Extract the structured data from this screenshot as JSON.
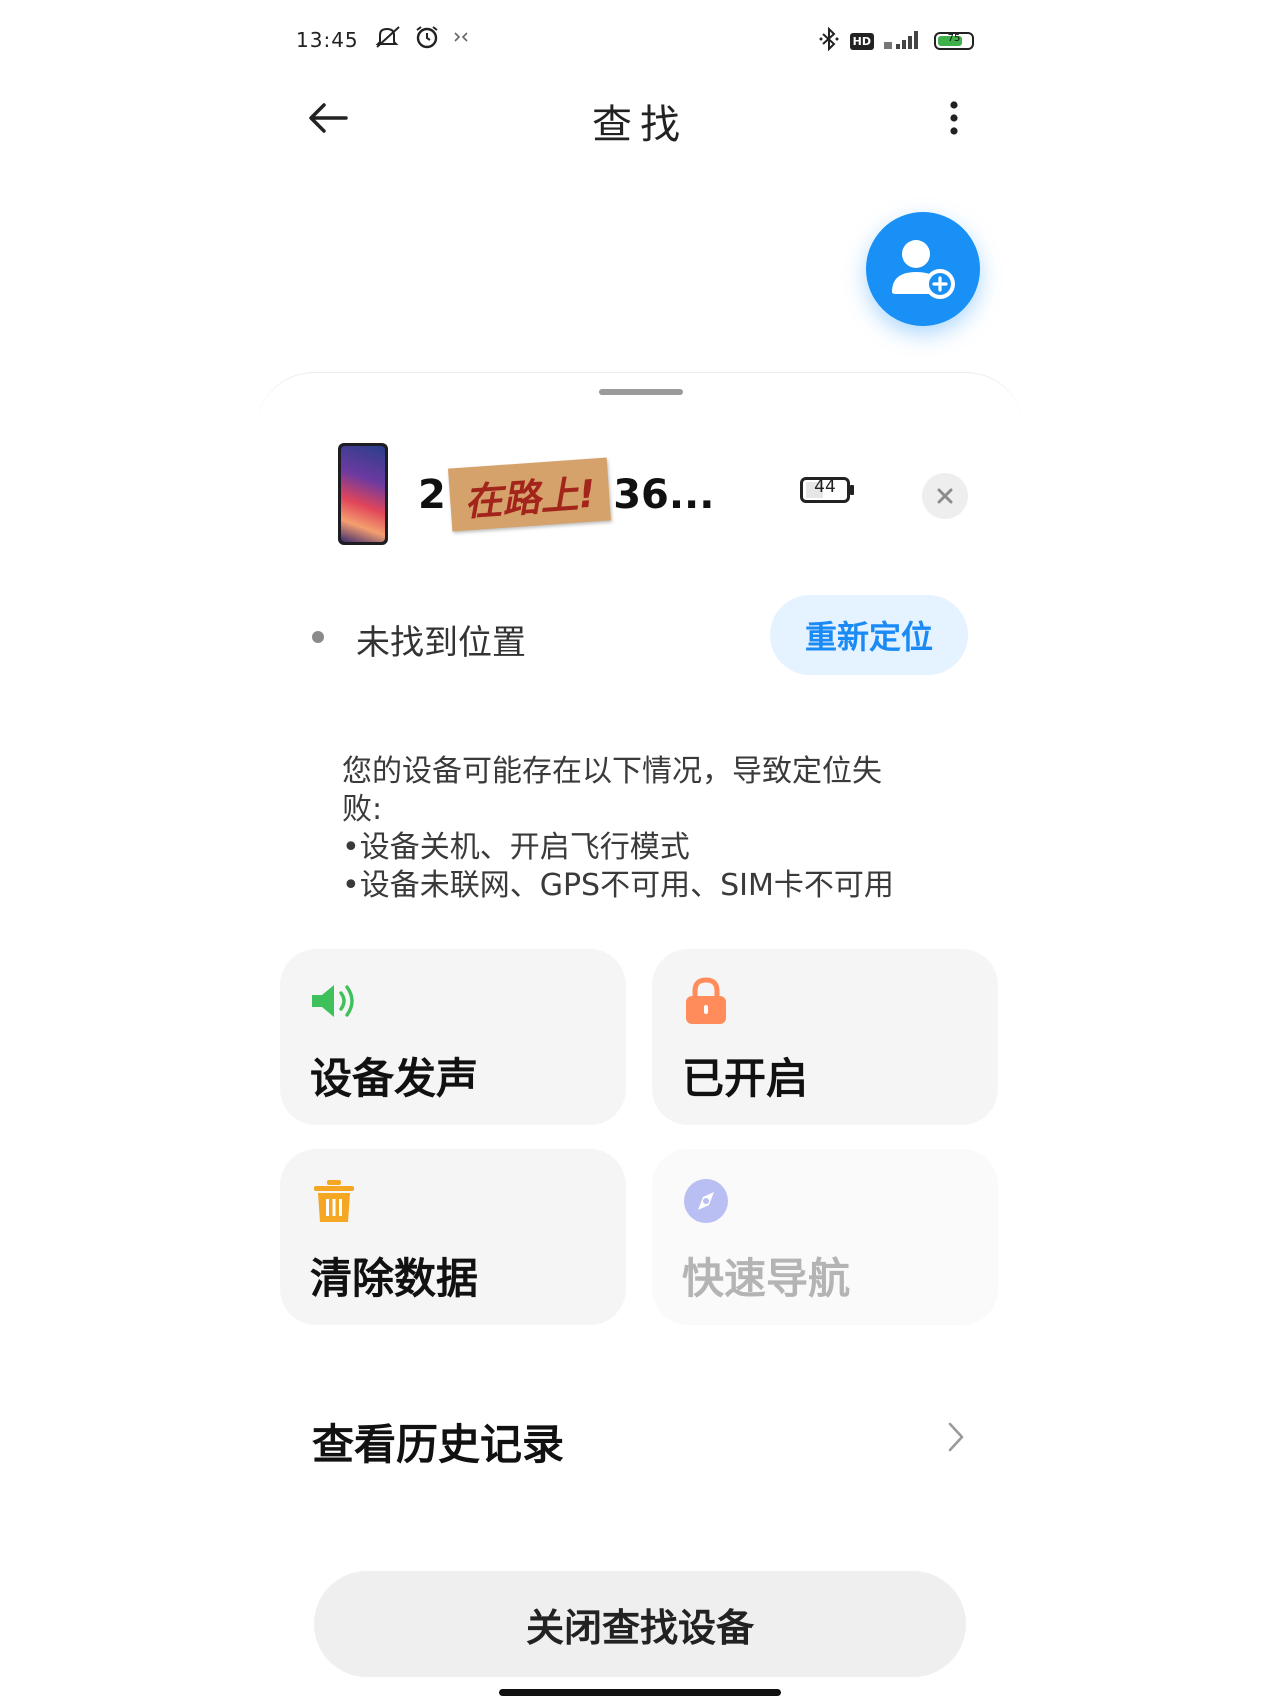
{
  "status_bar": {
    "time": "13:45",
    "battery_text": "75",
    "battery_level": 0.75,
    "icons_left": [
      "mute-icon",
      "alarm-icon",
      "notification-icon"
    ],
    "icons_right": [
      "bluetooth-icon",
      "hd-icon",
      "signal-icon",
      "battery-icon"
    ],
    "hd_label": "HD"
  },
  "header": {
    "title": "查找",
    "back_icon": "arrow-left-icon",
    "more_icon": "more-vertical-icon"
  },
  "fab": {
    "icon": "add-person-icon",
    "color": "#1890f5"
  },
  "device": {
    "name_prefix": "2",
    "sticker_text": "在路上!",
    "name_suffix": "36...",
    "battery": "44"
  },
  "location": {
    "status_text": "未找到位置",
    "relocate_label": "重新定位"
  },
  "info": {
    "line1": "您的设备可能存在以下情况，导致定位失",
    "line2": "败:",
    "line3": "•设备关机、开启飞行模式",
    "line4": "•设备未联网、GPS不可用、SIM卡不可用"
  },
  "actions": [
    {
      "label": "设备发声",
      "icon": "speaker-icon",
      "color": "#3ec15b",
      "enabled": true
    },
    {
      "label": "已开启",
      "icon": "lock-icon",
      "color": "#ff8c5a",
      "enabled": true
    },
    {
      "label": "清除数据",
      "icon": "trash-icon",
      "color": "#f5a623",
      "enabled": true
    },
    {
      "label": "快速导航",
      "icon": "compass-icon",
      "color": "#b9bff2",
      "enabled": false
    }
  ],
  "history": {
    "label": "查看历史记录"
  },
  "bottom_button": {
    "label": "关闭查找设备"
  },
  "colors": {
    "accent": "#1890f5",
    "relocate_bg": "#e5f2ff",
    "relocate_text": "#1a8af5"
  }
}
